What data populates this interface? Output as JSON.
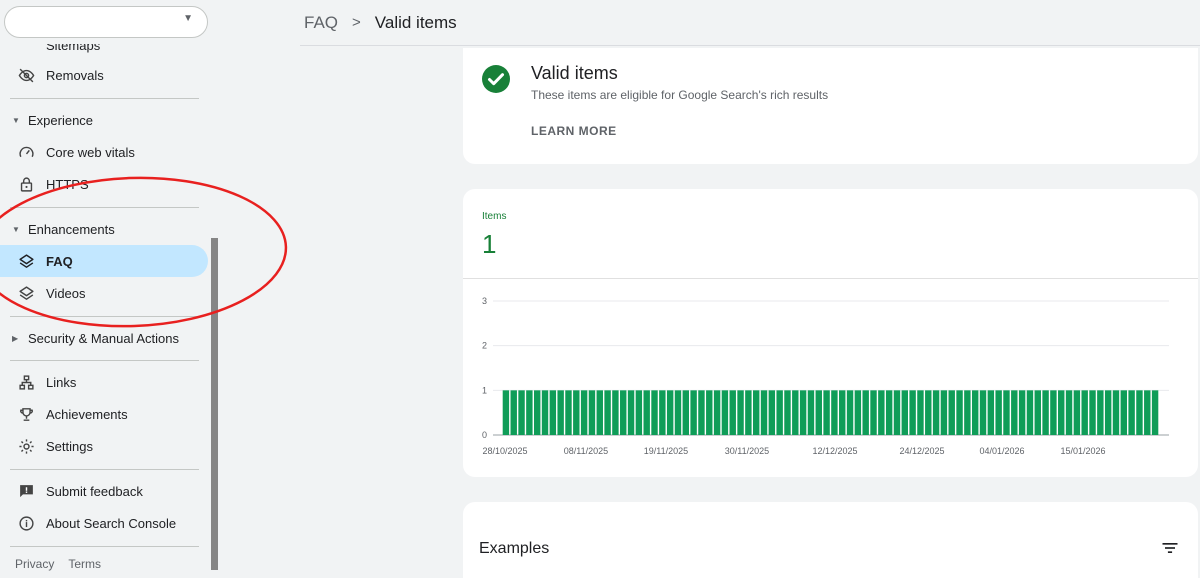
{
  "sidebar": {
    "partial_item": "Sitemaps",
    "removals": "Removals",
    "experience_section": "Experience",
    "core_web_vitals": "Core web vitals",
    "https": "HTTPS",
    "enhancements_section": "Enhancements",
    "faq": "FAQ",
    "videos": "Videos",
    "security_section": "Security & Manual Actions",
    "links": "Links",
    "achievements": "Achievements",
    "settings": "Settings",
    "submit_feedback": "Submit feedback",
    "about": "About Search Console",
    "privacy": "Privacy",
    "terms": "Terms"
  },
  "header": {
    "crumb_parent": "FAQ",
    "separator": ">",
    "crumb_current": "Valid items"
  },
  "status": {
    "title": "Valid items",
    "description": "These items are eligible for Google Search's rich results",
    "learn_more": "LEARN MORE"
  },
  "metric": {
    "label": "Items",
    "value": "1"
  },
  "chart_data": {
    "type": "bar",
    "ylim": [
      0,
      3
    ],
    "yticks": [
      0,
      1,
      2,
      3
    ],
    "grid": true,
    "bar_count": 84,
    "bar_value": 1,
    "x_tick_labels": [
      "28/10/2025",
      "08/11/2025",
      "19/11/2025",
      "30/11/2025",
      "12/12/2025",
      "24/12/2025",
      "04/01/2026",
      "15/01/2026"
    ],
    "bar_color": "#0f9d58"
  },
  "examples": {
    "title": "Examples"
  },
  "colors": {
    "accent_green": "#188038",
    "active_nav": "#c2e7ff",
    "annotation_red": "#e8201f"
  }
}
